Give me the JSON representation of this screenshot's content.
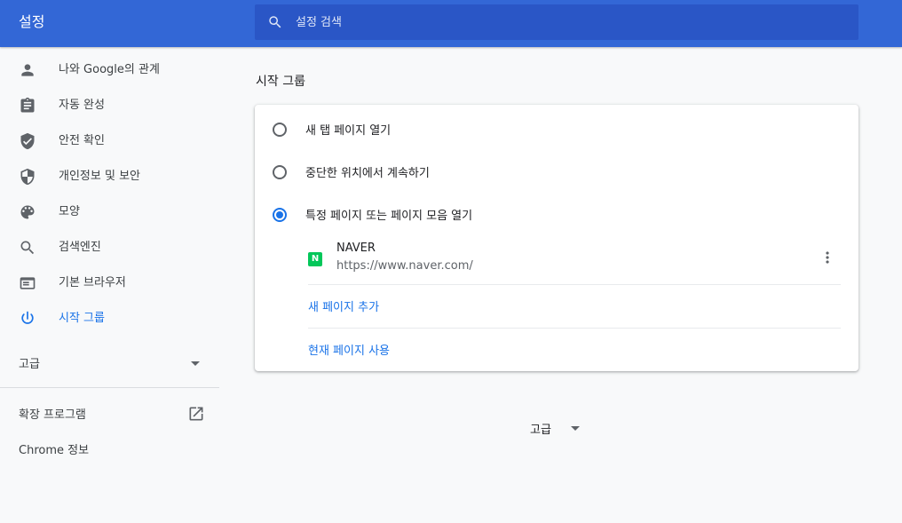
{
  "header": {
    "title": "설정",
    "search": {
      "placeholder": "설정 검색",
      "value": ""
    },
    "colors": {
      "bar": "#3367d6",
      "search_bg": "#2a56c6"
    }
  },
  "sidebar": {
    "items": [
      {
        "label": "나와 Google의 관계",
        "icon": "person-icon"
      },
      {
        "label": "자동 완성",
        "icon": "clipboard-icon"
      },
      {
        "label": "안전 확인",
        "icon": "shield-check-icon"
      },
      {
        "label": "개인정보 및 보안",
        "icon": "shield-half-icon"
      },
      {
        "label": "모양",
        "icon": "palette-icon"
      },
      {
        "label": "검색엔진",
        "icon": "search-icon"
      },
      {
        "label": "기본 브라우저",
        "icon": "browser-window-icon"
      },
      {
        "label": "시작 그룹",
        "icon": "power-icon",
        "active": true
      }
    ],
    "advanced_label": "고급",
    "extensions_label": "확장 프로그램",
    "about_label": "Chrome 정보",
    "accent_color": "#1a73e8"
  },
  "main": {
    "section_title": "시작 그룹",
    "options": [
      {
        "label": "새 탭 페이지 열기",
        "selected": false
      },
      {
        "label": "중단한 위치에서 계속하기",
        "selected": false
      },
      {
        "label": "특정 페이지 또는 페이지 모음 열기",
        "selected": true
      }
    ],
    "pages": [
      {
        "name": "NAVER",
        "url": "https://www.naver.com/",
        "favicon_letter": "N",
        "favicon_color": "#03c75a"
      }
    ],
    "add_page_label": "새 페이지 추가",
    "use_current_label": "현재 페이지 사용",
    "advanced_label": "고급"
  }
}
